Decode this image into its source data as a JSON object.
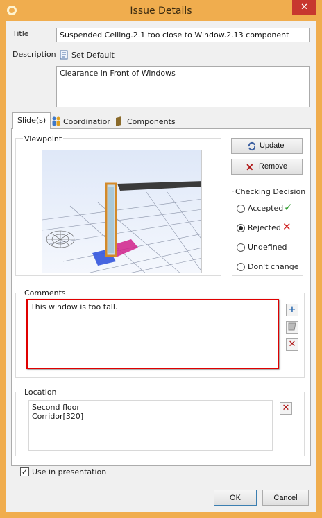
{
  "window": {
    "title": "Issue Details",
    "close_symbol": "✕"
  },
  "title_field": {
    "label": "Title",
    "value": "Suspended Ceiling.2.1 too close to Window.2.13 component"
  },
  "description": {
    "label": "Description",
    "set_default_label": "Set Default",
    "value": "Clearance in Front of Windows"
  },
  "tabs": [
    {
      "label": "Slide(s)"
    },
    {
      "label": "Coordination"
    },
    {
      "label": "Components"
    }
  ],
  "viewpoint": {
    "label": "Viewpoint",
    "update_label": "Update",
    "remove_label": "Remove"
  },
  "checking_decision": {
    "label": "Checking Decision",
    "options": [
      "Accepted",
      "Rejected",
      "Undefined",
      "Don't change"
    ],
    "selected": "Rejected",
    "accepted_symbol": "✓",
    "rejected_symbol": "✕"
  },
  "comments": {
    "label": "Comments",
    "text": "This window is too tall."
  },
  "location": {
    "label": "Location",
    "lines": [
      "Second floor",
      "Corridor[320]"
    ]
  },
  "use_in_presentation": {
    "label": "Use in presentation",
    "checked": true
  },
  "footer": {
    "ok_label": "OK",
    "cancel_label": "Cancel"
  },
  "colors": {
    "titlebar": "#f0ad4e",
    "close": "#c7372f",
    "highlight": "#e00000",
    "accepted": "#2a9a2a",
    "rejected": "#d02020"
  }
}
